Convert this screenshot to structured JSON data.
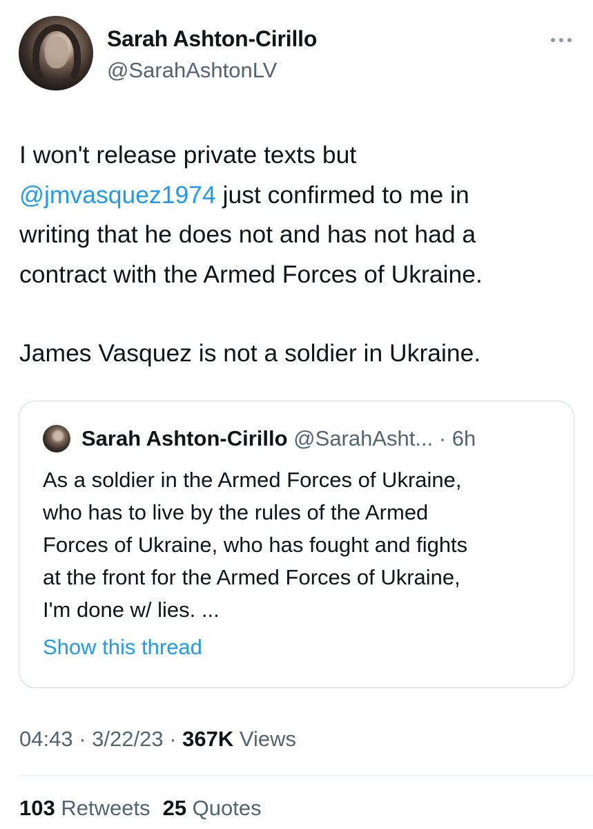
{
  "author": {
    "display_name": "Sarah Ashton-Cirillo",
    "handle": "@SarahAshtonLV"
  },
  "tweet": {
    "mention": "@jmvasquez1974",
    "line1": "I won't release private texts but",
    "line2_after_mention": " just confirmed to me in",
    "line3": "writing that he does not and has not had a",
    "line4": "contract with the Armed Forces of Ukraine.",
    "line5": "James Vasquez is not a soldier in Ukraine."
  },
  "quoted_tweet": {
    "display_name": "Sarah Ashton-Cirillo",
    "handle": "@SarahAsht...",
    "separator": " · ",
    "time": "6h",
    "lines": [
      "As a soldier in the Armed Forces of Ukraine,",
      "who has to live by the rules of the Armed",
      "Forces of Ukraine, who has fought and fights",
      "at the front for the Armed Forces of Ukraine,",
      "I'm done w/ lies. ..."
    ],
    "show_thread": "Show this thread"
  },
  "meta": {
    "time": "04:43",
    "separator": " · ",
    "date": "3/22/23",
    "views_count": "367K",
    "views_label": " Views"
  },
  "stats": {
    "retweets_count": "103",
    "retweets_label": " Retweets",
    "quotes_count": "25",
    "quotes_label": " Quotes"
  },
  "icons": {
    "more": "more-dots-icon"
  },
  "colors": {
    "link": "#1d9bf0",
    "secondary_text": "#536471",
    "primary_text": "#0f1419",
    "border": "#cfd9de"
  }
}
